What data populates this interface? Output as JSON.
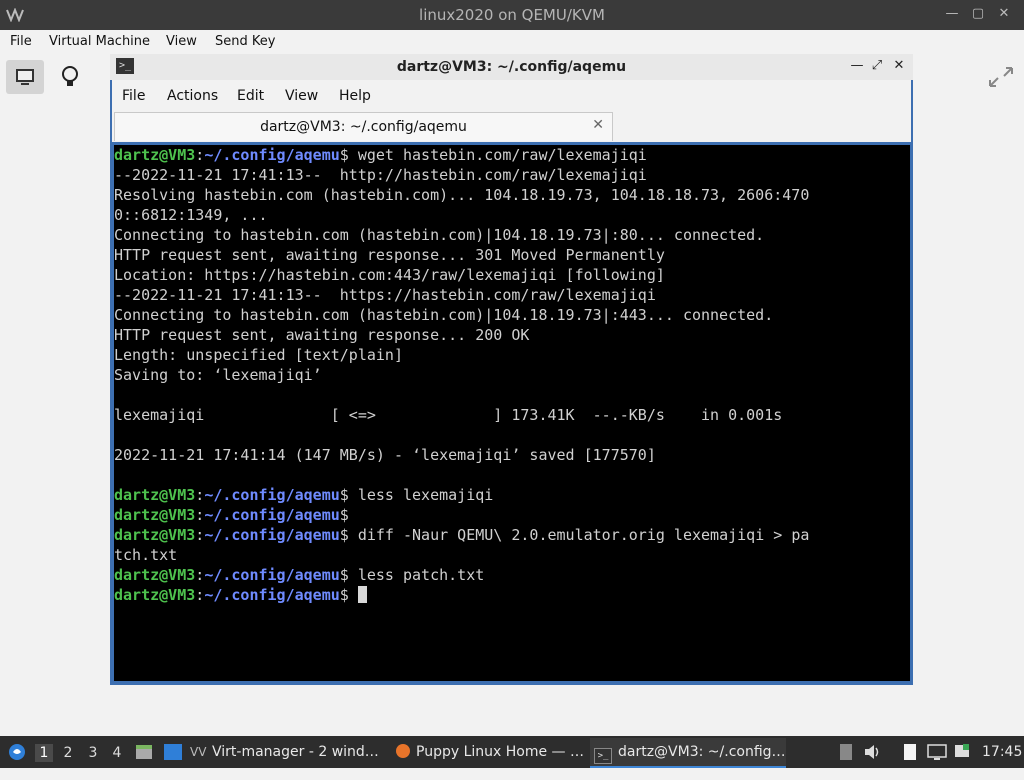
{
  "window": {
    "title": "linux2020 on QEMU/KVM"
  },
  "menubar": {
    "items": [
      "File",
      "Virtual Machine",
      "View",
      "Send Key"
    ]
  },
  "terminal": {
    "title": "dartz@VM3: ~/.config/aqemu",
    "menu": [
      "File",
      "Actions",
      "Edit",
      "View",
      "Help"
    ],
    "tab_label": "dartz@VM3: ~/.config/aqemu",
    "lines": [
      {
        "prompt": true,
        "user": "dartz@VM3",
        "path": "~/.config/aqemu",
        "cmd": " wget hastebin.com/raw/lexemajiqi"
      },
      {
        "text": "--2022-11-21 17:41:13--  http://hastebin.com/raw/lexemajiqi"
      },
      {
        "text": "Resolving hastebin.com (hastebin.com)... 104.18.19.73, 104.18.18.73, 2606:470"
      },
      {
        "text": "0::6812:1349, ..."
      },
      {
        "text": "Connecting to hastebin.com (hastebin.com)|104.18.19.73|:80... connected."
      },
      {
        "text": "HTTP request sent, awaiting response... 301 Moved Permanently"
      },
      {
        "text": "Location: https://hastebin.com:443/raw/lexemajiqi [following]"
      },
      {
        "text": "--2022-11-21 17:41:13--  https://hastebin.com/raw/lexemajiqi"
      },
      {
        "text": "Connecting to hastebin.com (hastebin.com)|104.18.19.73|:443... connected."
      },
      {
        "text": "HTTP request sent, awaiting response... 200 OK"
      },
      {
        "text": "Length: unspecified [text/plain]"
      },
      {
        "text": "Saving to: ‘lexemajiqi’"
      },
      {
        "text": ""
      },
      {
        "text": "lexemajiqi              [ <=>             ] 173.41K  --.-KB/s    in 0.001s"
      },
      {
        "text": ""
      },
      {
        "text": "2022-11-21 17:41:14 (147 MB/s) - ‘lexemajiqi’ saved [177570]"
      },
      {
        "text": ""
      },
      {
        "prompt": true,
        "user": "dartz@VM3",
        "path": "~/.config/aqemu",
        "cmd": " less lexemajiqi"
      },
      {
        "prompt": true,
        "user": "dartz@VM3",
        "path": "~/.config/aqemu",
        "cmd": ""
      },
      {
        "prompt": true,
        "user": "dartz@VM3",
        "path": "~/.config/aqemu",
        "cmd": " diff -Naur QEMU\\ 2.0.emulator.orig lexemajiqi > pa"
      },
      {
        "text": "tch.txt"
      },
      {
        "prompt": true,
        "user": "dartz@VM3",
        "path": "~/.config/aqemu",
        "cmd": " less patch.txt"
      },
      {
        "prompt": true,
        "user": "dartz@VM3",
        "path": "~/.config/aqemu",
        "cmd": " ",
        "cursor": true
      }
    ]
  },
  "taskbar": {
    "workspaces": [
      "1",
      "2",
      "3",
      "4"
    ],
    "tasks": [
      {
        "label": "Virt-manager - 2 wind…",
        "icon": "virt-manager-icon"
      },
      {
        "label": "Puppy Linux Home — …",
        "icon": "firefox-icon"
      },
      {
        "label": "dartz@VM3: ~/.config…",
        "icon": "terminal-icon"
      }
    ],
    "clock": "17:45"
  }
}
